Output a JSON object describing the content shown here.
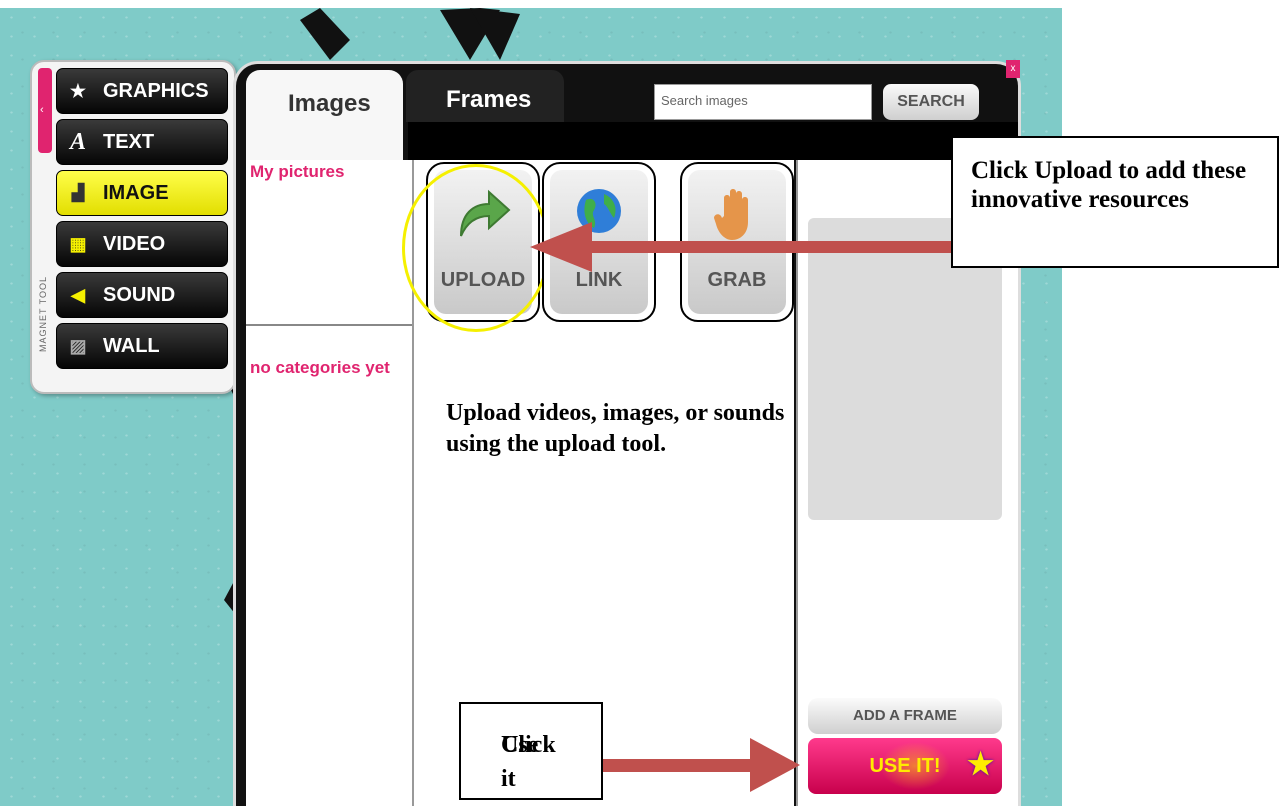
{
  "magnet_tool": {
    "vertical_label": "MAGNET TOOL",
    "collapse_glyph": "‹",
    "items": [
      {
        "label": "GRAPHICS",
        "icon": "star-icon"
      },
      {
        "label": "TEXT",
        "icon": "text-a-icon"
      },
      {
        "label": "IMAGE",
        "icon": "image-icon"
      },
      {
        "label": "VIDEO",
        "icon": "film-icon"
      },
      {
        "label": "SOUND",
        "icon": "speaker-icon"
      },
      {
        "label": "WALL",
        "icon": "wall-pattern-icon"
      }
    ]
  },
  "tabs": {
    "images": "Images",
    "frames": "Frames"
  },
  "search": {
    "placeholder": "Search images",
    "button": "SEARCH"
  },
  "close_label": "x",
  "sidebar": {
    "my_pictures": "My pictures",
    "no_categories": "no categories yet"
  },
  "tools": {
    "upload": "UPLOAD",
    "link": "LINK",
    "grab": "GRAB"
  },
  "actions": {
    "add_frame": "ADD A FRAME",
    "use_it": "USE IT!"
  },
  "annotations": {
    "upload_callout": "Click Upload to add these innovative resources",
    "upload_note": "Upload videos, images, or sounds using the upload tool.",
    "use_it_callout_line1": "Click",
    "use_it_callout_line2": "Use it"
  },
  "colors": {
    "accent_pink": "#e0246f",
    "active_yellow": "#f5f000",
    "arrow_red": "#c0504d",
    "background_teal": "#7fcbc8"
  }
}
